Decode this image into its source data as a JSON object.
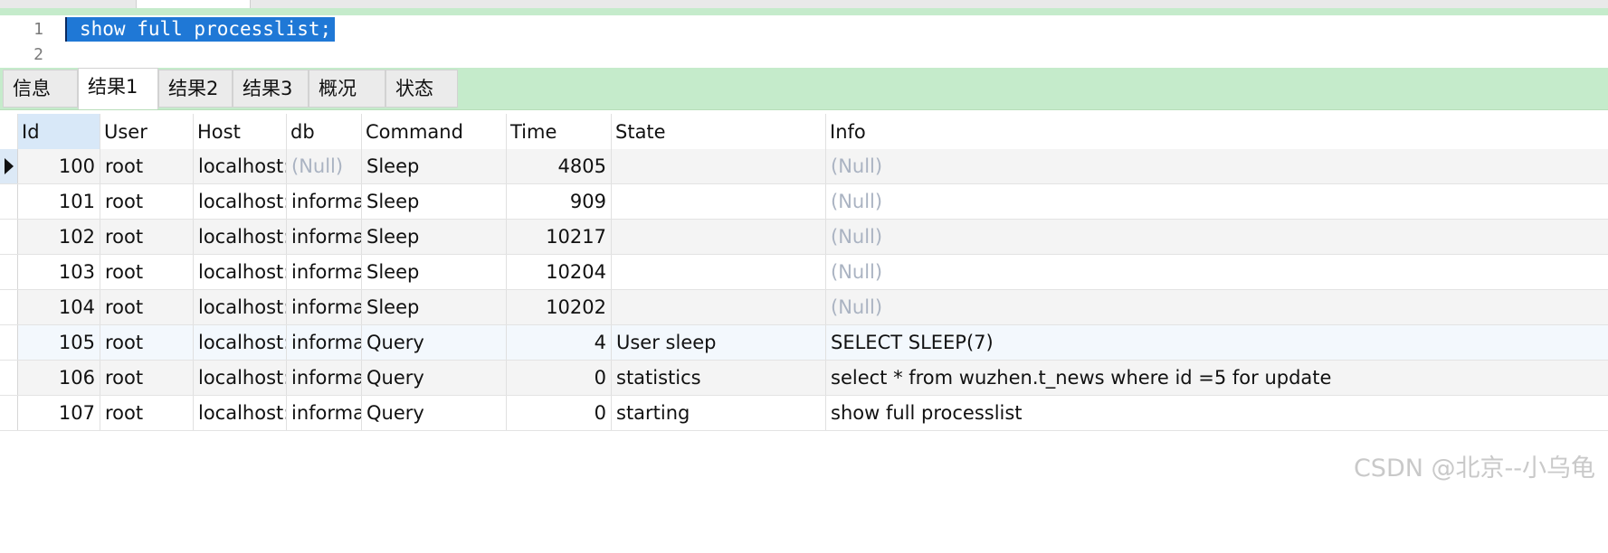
{
  "editor": {
    "lines": [
      {
        "number": "1",
        "code": "show full processlist;"
      },
      {
        "number": "2",
        "code": ""
      }
    ]
  },
  "tabs": [
    {
      "label": "信息"
    },
    {
      "label": "结果1",
      "active": true
    },
    {
      "label": "结果2"
    },
    {
      "label": "结果3"
    },
    {
      "label": "概况"
    },
    {
      "label": "状态"
    }
  ],
  "grid": {
    "columns": [
      "Id",
      "User",
      "Host",
      "db",
      "Command",
      "Time",
      "State",
      "Info"
    ],
    "selected_column": "Id",
    "current_row": 0,
    "rows": [
      [
        "100",
        "root",
        "localhost:",
        "(Null)",
        "Sleep",
        "4805",
        "",
        "(Null)"
      ],
      [
        "101",
        "root",
        "localhost:",
        "informa",
        "Sleep",
        "909",
        "",
        "(Null)"
      ],
      [
        "102",
        "root",
        "localhost:",
        "informa",
        "Sleep",
        "10217",
        "",
        "(Null)"
      ],
      [
        "103",
        "root",
        "localhost:",
        "informa",
        "Sleep",
        "10204",
        "",
        "(Null)"
      ],
      [
        "104",
        "root",
        "localhost:",
        "informa",
        "Sleep",
        "10202",
        "",
        "(Null)"
      ],
      [
        "105",
        "root",
        "localhost:",
        "informa",
        "Query",
        "4",
        "User sleep",
        "SELECT SLEEP(7)"
      ],
      [
        "106",
        "root",
        "localhost:",
        "informa",
        "Query",
        "0",
        "statistics",
        "select * from wuzhen.t_news where id =5 for update"
      ],
      [
        "107",
        "root",
        "localhost:",
        "informa",
        "Query",
        "0",
        "starting",
        "show full processlist"
      ]
    ]
  },
  "watermark": "CSDN @北京--小乌龟",
  "colors": {
    "accent_green": "#c5ebcb",
    "selection_blue": "#1f78d6",
    "null_text": "#aab3c2"
  }
}
